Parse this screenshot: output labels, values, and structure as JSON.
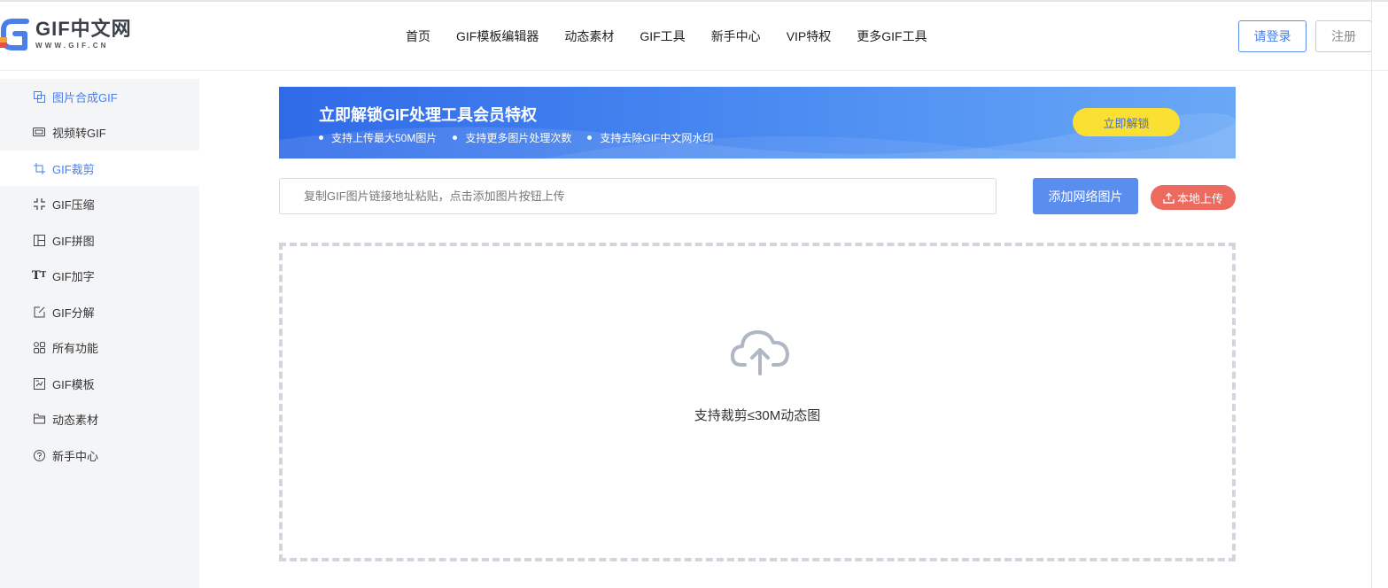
{
  "brand": {
    "title": "GIF中文网",
    "subtitle": "WWW.GIF.CN"
  },
  "nav": [
    "首页",
    "GIF模板编辑器",
    "动态素材",
    "GIF工具",
    "新手中心",
    "VIP特权",
    "更多GIF工具"
  ],
  "auth": {
    "login": "请登录",
    "register": "注册"
  },
  "sidebar": {
    "items": [
      {
        "label": "图片合成GIF",
        "icon": "layers-icon"
      },
      {
        "label": "视频转GIF",
        "icon": "video-icon"
      },
      {
        "label": "GIF裁剪",
        "icon": "crop-icon"
      },
      {
        "label": "GIF压缩",
        "icon": "compress-icon"
      },
      {
        "label": "GIF拼图",
        "icon": "collage-icon"
      },
      {
        "label": "GIF加字",
        "icon": "text-icon"
      },
      {
        "label": "GIF分解",
        "icon": "edit-icon"
      },
      {
        "label": "所有功能",
        "icon": "grid-icon"
      },
      {
        "label": "GIF模板",
        "icon": "template-icon"
      },
      {
        "label": "动态素材",
        "icon": "folder-icon"
      },
      {
        "label": "新手中心",
        "icon": "help-icon"
      }
    ],
    "active_index": 2
  },
  "banner": {
    "title": "立即解锁GIF处理工具会员特权",
    "points": [
      "支持上传最大50M图片",
      "支持更多图片处理次数",
      "支持去除GIF中文网水印"
    ],
    "button": "立即解锁"
  },
  "upload": {
    "url_placeholder": "复制GIF图片链接地址粘贴，点击添加图片按钮上传",
    "add_button": "添加网络图片",
    "local_button": "本地上传"
  },
  "dropzone": {
    "icon": "cloud-upload-icon",
    "text": "支持裁剪≤30M动态图"
  },
  "colors": {
    "accent": "#4a7ee8",
    "banner": "#2f6ae8",
    "unlock": "#f9e033",
    "local_upload": "#ec6a5e"
  }
}
